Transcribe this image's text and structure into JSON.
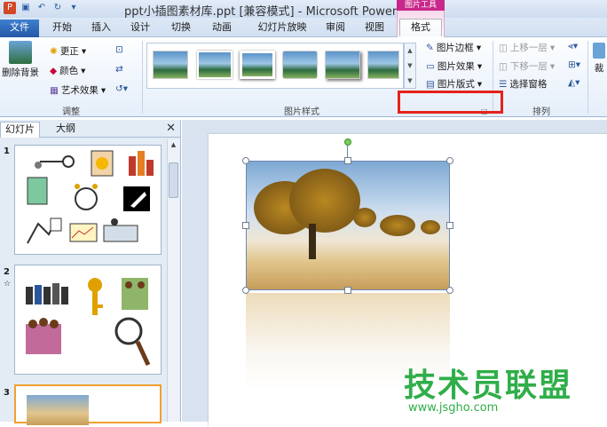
{
  "window": {
    "title": "ppt小插图素材库.ppt [兼容模式] - Microsoft Power..."
  },
  "context_tab_header": "图片工具",
  "tabs": [
    "文件",
    "开始",
    "插入",
    "设计",
    "切换",
    "动画",
    "幻灯片放映",
    "审阅",
    "视图",
    "格式"
  ],
  "active_tab": "格式",
  "ribbon": {
    "adjust": {
      "remove_bg": "删除背景",
      "corrections": "更正",
      "color": "颜色",
      "artistic": "艺术效果",
      "label": "调整"
    },
    "styles": {
      "label": "图片样式",
      "border": "图片边框",
      "effects": "图片效果",
      "layout": "图片版式"
    },
    "arrange": {
      "label": "排列",
      "bring_forward": "上移一层",
      "send_backward": "下移一层",
      "selection_pane": "选择窗格"
    },
    "size_partial": "裁"
  },
  "left_panel": {
    "tabs": [
      "幻灯片",
      "大纲"
    ],
    "slide_numbers": [
      "1",
      "2",
      "3"
    ],
    "slide2_star": "☆"
  },
  "watermark": {
    "text": "技术员联盟",
    "url": "www.jsgho.com"
  },
  "colors": {
    "accent_blue": "#2b579a",
    "context_pink": "#c9288a",
    "highlight_red": "#e5221a",
    "watermark_green": "#2fae49"
  }
}
